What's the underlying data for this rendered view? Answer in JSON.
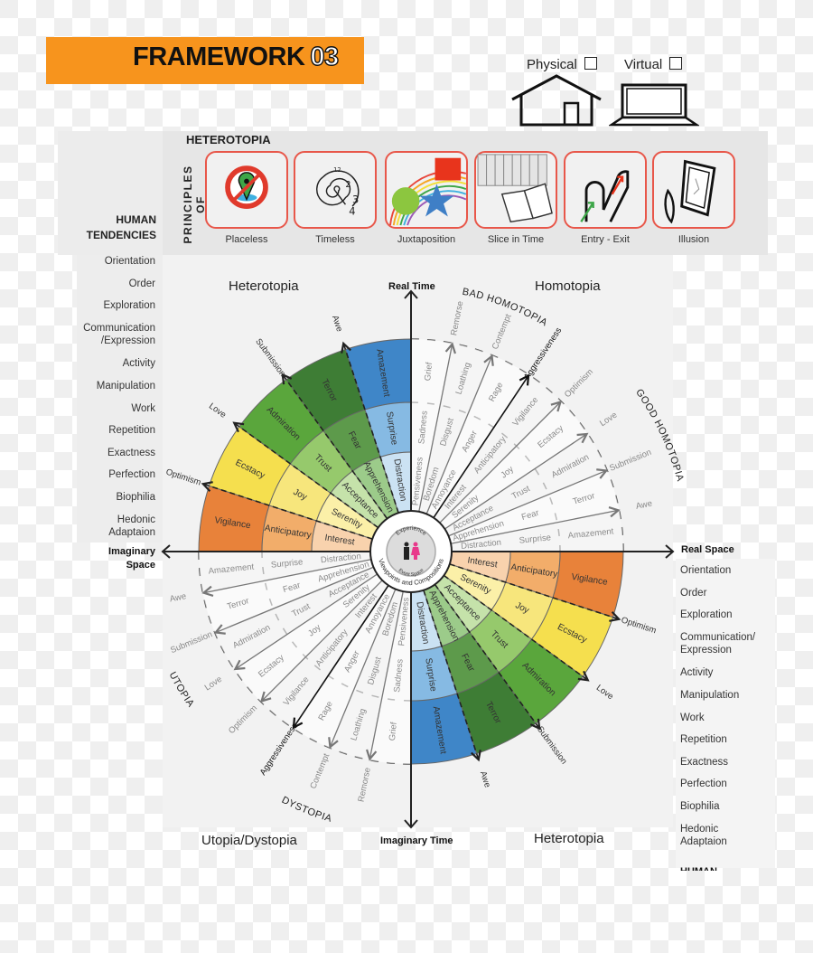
{
  "banner": {
    "title": "FRAMEWORK",
    "number": "03",
    "color": "#f7941d"
  },
  "modes": [
    {
      "label": "Physical",
      "icon": "house-icon",
      "checked": false
    },
    {
      "label": "Virtual",
      "icon": "laptop-icon",
      "checked": false
    }
  ],
  "principles": {
    "title": "HETEROTOPIA",
    "vertical_label": "PRINCIPLES OF",
    "border_color": "#e8574a",
    "items": [
      {
        "label": "Placeless",
        "icon": "no-location-icon"
      },
      {
        "label": "Timeless",
        "icon": "spiral-clock-icon"
      },
      {
        "label": "Juxtaposition",
        "icon": "rainbow-shapes-icon"
      },
      {
        "label": "Slice in Time",
        "icon": "books-icon"
      },
      {
        "label": "Entry - Exit",
        "icon": "doorway-arrows-icon"
      },
      {
        "label": "Illusion",
        "icon": "mirror-icon"
      }
    ]
  },
  "human_tendencies": {
    "heading_line1": "HUMAN",
    "heading_line2": "TENDENCIES",
    "items": [
      "Orientation",
      "Order",
      "Exploration",
      "Communication\n/Expression",
      "Activity",
      "Manipulation",
      "Work",
      "Repetition",
      "Exactness",
      "Perfection",
      "Biophilia",
      "Hedonic\nAdaptaion"
    ]
  },
  "human_tendencies_right": {
    "items": [
      "Orientation",
      "Order",
      "Exploration",
      "Communication/\nExpression",
      "Activity",
      "Manipulation",
      "Work",
      "Repetition",
      "Exactness",
      "Perfection",
      "Biophilia",
      "Hedonic\nAdaptaion"
    ],
    "cut_heading": "HUMAN"
  },
  "quadrants": {
    "top_left": "Heterotopia",
    "top_right": "Homotopia",
    "bottom_left": "Utopia/Dystopia",
    "bottom_right": "Heterotopia"
  },
  "axes": {
    "top": "Real Time",
    "bottom": "Imaginary Time",
    "right": "Real Space",
    "left": "Imaginary Space"
  },
  "arc_labels": {
    "bad_homotopia": "BAD HOMOTOPIA",
    "good_homotopia": "GOOD HOMOTOPIA",
    "utopia": "UTOPIA",
    "dystopia": "DYSTOPIA"
  },
  "center": {
    "line1": "Experience",
    "line2": "Event Space",
    "ring_text": "Viewpoints and Compositions",
    "male_color": "#222222",
    "female_color": "#e8388a"
  },
  "wheel": {
    "colored_families": [
      {
        "outer": "Vigilance",
        "middle": "Anticipatory",
        "inner": "Interest",
        "colors": [
          "#e8823a",
          "#f2ad6a",
          "#f8d2ad"
        ]
      },
      {
        "outer": "Ecstacy",
        "middle": "Joy",
        "inner": "Serenity",
        "colors": [
          "#f5df4e",
          "#f7e67c",
          "#fbf0a8"
        ]
      },
      {
        "outer": "Admiration",
        "middle": "Trust",
        "inner": "Acceptance",
        "colors": [
          "#5aa63c",
          "#96c96c",
          "#c5e2aa"
        ]
      },
      {
        "outer": "Terror",
        "middle": "Fear",
        "inner": "Apprehension",
        "colors": [
          "#3e7d35",
          "#5d9a4b",
          "#9ccb8a"
        ]
      },
      {
        "outer": "Amazement",
        "middle": "Surprise",
        "inner": "Distraction",
        "colors": [
          "#3f86c8",
          "#86bae3",
          "#cbe2f3"
        ]
      }
    ],
    "colored_arrows": [
      "Optimism",
      "Love",
      "Submission",
      "Awe"
    ],
    "gray_families": [
      {
        "inner": "Pensiveness",
        "middle": "Sadness",
        "outer": "Grief"
      },
      {
        "inner": "Boredom",
        "middle": "Disgust",
        "outer": "Loathing"
      },
      {
        "inner": "Annoyance",
        "middle": "Anger",
        "outer": "Rage"
      },
      {
        "inner": "Interest",
        "middle": "Anticipatory",
        "outer": "Vigilance"
      },
      {
        "inner": "Serenity",
        "middle": "Joy",
        "outer": "Ecstacy"
      },
      {
        "inner": "Acceptance",
        "middle": "Trust",
        "outer": "Admiration"
      },
      {
        "inner": "Apprehension",
        "middle": "Fear",
        "outer": "Terror"
      },
      {
        "inner": "Distraction",
        "middle": "Surprise",
        "outer": "Amazement"
      }
    ],
    "gray_arrows": [
      "Remorse",
      "Contempt",
      "Aggressiveness",
      "Optimism",
      "Love",
      "Submission",
      "Awe"
    ],
    "highlight_arrow": "Aggressiveness"
  }
}
